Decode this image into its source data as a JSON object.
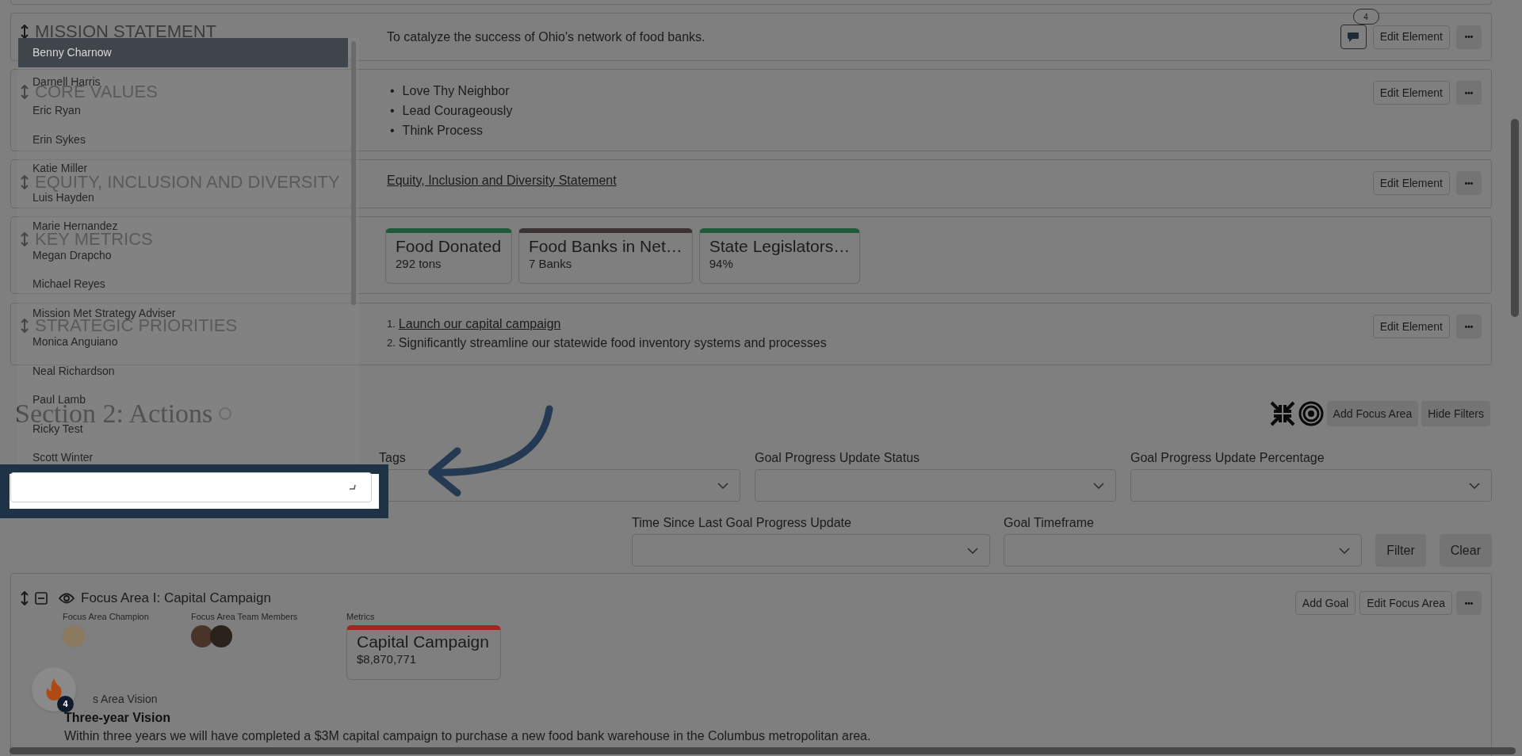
{
  "elements": [
    {
      "kind": "text",
      "title": "MISSION STATEMENT",
      "text": "To catalyze the success of Ohio's network of food banks.",
      "comments": "4",
      "edit": "Edit Element",
      "menu": "•••"
    },
    {
      "kind": "bullets",
      "title": "CORE VALUES",
      "items": [
        {
          "marker": "•",
          "text": "Love Thy Neighbor"
        },
        {
          "marker": "•",
          "text": "Lead Courageously"
        },
        {
          "marker": "•",
          "text": "Think Process"
        }
      ],
      "edit": "Edit Element",
      "menu": "•••"
    },
    {
      "kind": "link",
      "title": "EQUITY, INCLUSION AND DIVERSITY",
      "link": "Equity, Inclusion and Diversity Statement",
      "edit": "Edit Element",
      "menu": "•••"
    },
    {
      "kind": "metrics",
      "title": "KEY METRICS",
      "metrics": [
        {
          "name": "Food Donated",
          "value": "292 tons",
          "color": "#1f5a3a"
        },
        {
          "name": "Food Banks in Net…",
          "value": "7 Banks",
          "color": "#3a3532"
        },
        {
          "name": "State Legislators…",
          "value": "94%",
          "color": "#1f5a3a"
        }
      ]
    },
    {
      "kind": "numbered",
      "title": "STRATEGIC PRIORITIES",
      "items": [
        {
          "marker": "1.",
          "text": "Launch our capital campaign",
          "link": true
        },
        {
          "marker": "2.",
          "text": "Significantly streamline our statewide food inventory systems and processes",
          "link": false
        }
      ],
      "edit": "Edit Element",
      "menu": "•••"
    }
  ],
  "section": {
    "title": "Section 2: Actions",
    "buttons": [
      "Add Focus Area",
      "Hide Filters"
    ]
  },
  "filters": {
    "row_1": [
      {
        "label": "Tags"
      },
      {
        "label": "Goal Progress Update Status"
      },
      {
        "label": "Goal Progress Update Percentage"
      }
    ],
    "row_2": [
      {
        "label": "Time Since Last Goal Progress Update"
      },
      {
        "label": "Goal Timeframe"
      }
    ],
    "buttons": [
      "Filter",
      "Clear"
    ]
  },
  "people_dropdown": {
    "options": [
      {
        "label": "Benny Charnow",
        "selected": true
      },
      {
        "label": "Darnell Harris",
        "selected": false
      },
      {
        "label": "Eric Ryan",
        "selected": false
      },
      {
        "label": "Erin Sykes",
        "selected": false
      },
      {
        "label": "Katie Miller",
        "selected": false
      },
      {
        "label": "Luis Hayden",
        "selected": false
      },
      {
        "label": "Marie Hernandez",
        "selected": false
      },
      {
        "label": "Megan Drapcho",
        "selected": false
      },
      {
        "label": "Michael Reyes",
        "selected": false
      },
      {
        "label": "Mission Met Strategy Adviser",
        "selected": false
      },
      {
        "label": "Monica Anguiano",
        "selected": false
      },
      {
        "label": "Neal Richardson",
        "selected": false
      },
      {
        "label": "Paul Lamb",
        "selected": false
      },
      {
        "label": "Ricky Test",
        "selected": false
      },
      {
        "label": "Scott Winter",
        "selected": false
      }
    ]
  },
  "focus_area": {
    "title": "Focus Area I: Capital Campaign",
    "champion_label": "Focus Area Champion",
    "team_label": "Focus Area Team Members",
    "metrics_label": "Metrics",
    "metric": {
      "name": "Capital Campaign",
      "value": "$8,870,771",
      "color": "#a0271d"
    },
    "buttons": [
      "Add Goal",
      "Edit Focus Area"
    ],
    "menu": "•••",
    "vision_label": "s Area Vision",
    "vision_title": "Three-year Vision",
    "vision_text": "Within three years we will have completed a $3M capital campaign to purchase a new food bank warehouse in the Columbus metropolitan area."
  },
  "chat_button": {
    "badge": "4"
  }
}
